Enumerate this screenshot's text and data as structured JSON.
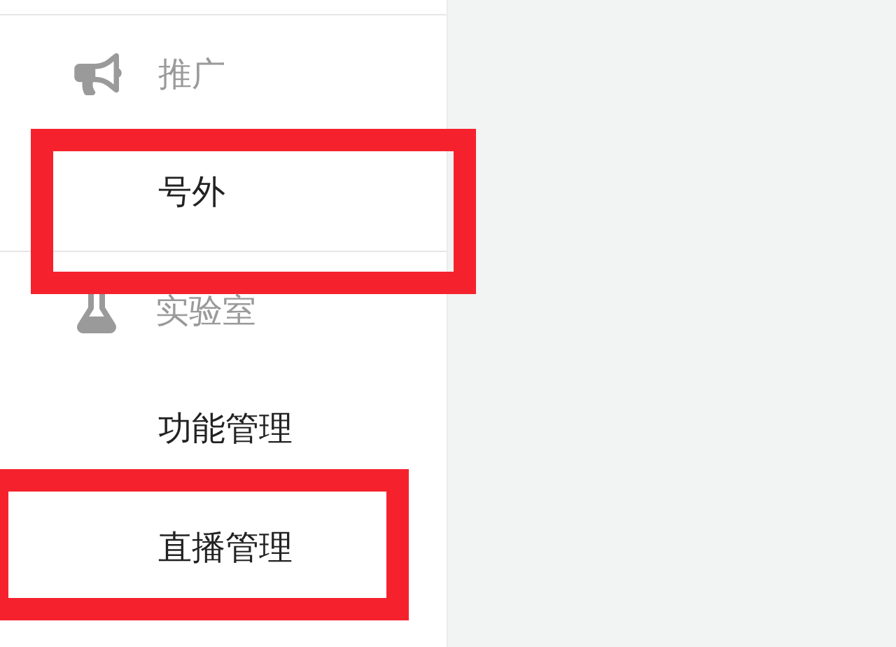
{
  "sidebar": {
    "sections": [
      {
        "title": "推广",
        "kind": "megaphone",
        "items": [
          {
            "label": "号外",
            "highlighted": true
          }
        ]
      },
      {
        "title": "实验室",
        "kind": "flask",
        "items": [
          {
            "label": "功能管理",
            "highlighted": false
          },
          {
            "label": "直播管理",
            "highlighted": true
          }
        ]
      }
    ]
  }
}
